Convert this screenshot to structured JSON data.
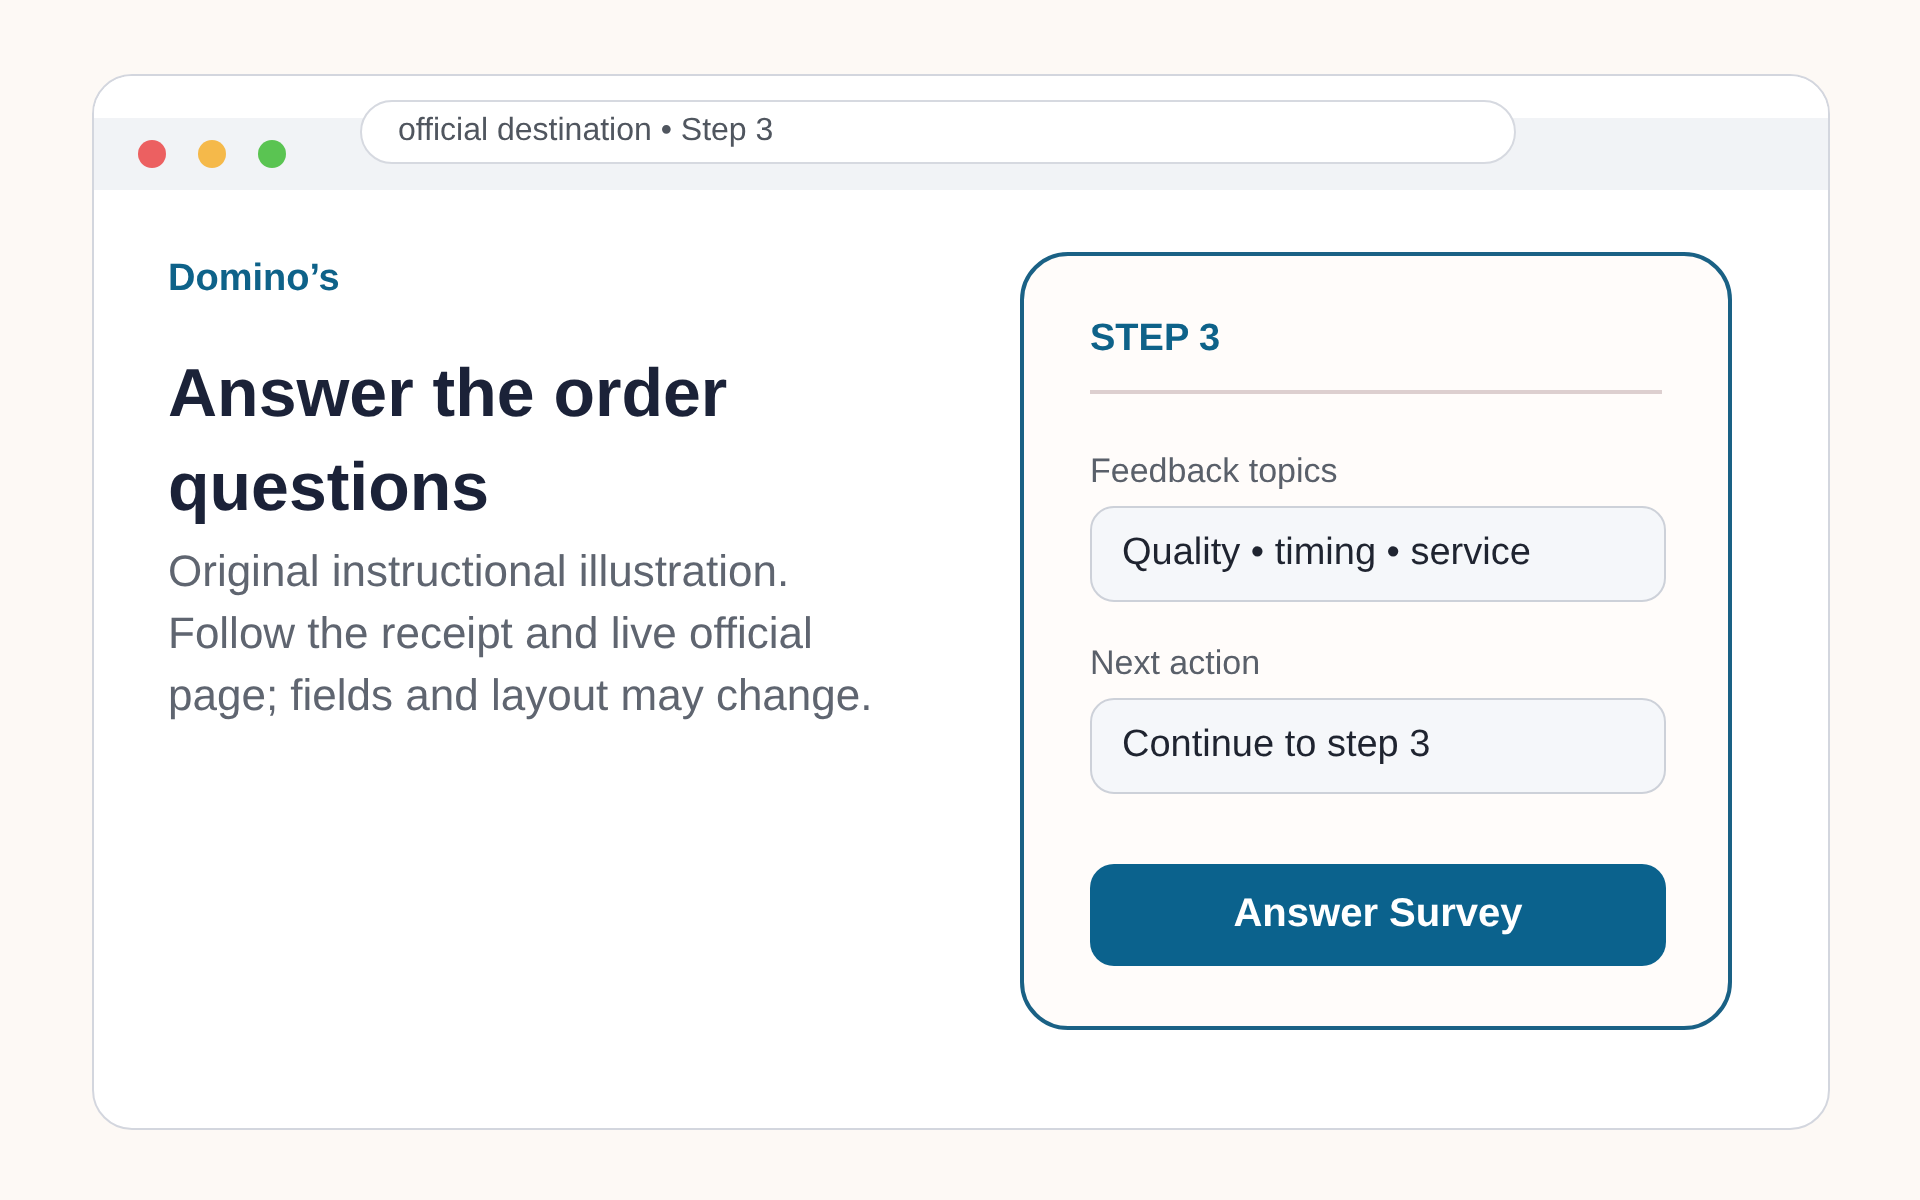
{
  "window": {
    "address_bar": "official destination • Step 3"
  },
  "intro": {
    "brand": "Domino’s",
    "heading": "Answer the order questions",
    "body": "Original instructional illustration. Follow the receipt and live official page; fields and layout may change."
  },
  "card": {
    "step": "STEP 3",
    "fields": [
      {
        "label": "Feedback topics",
        "value": "Quality • timing • service"
      },
      {
        "label": "Next action",
        "value": "Continue to step 3"
      }
    ],
    "button": "Answer Survey"
  }
}
